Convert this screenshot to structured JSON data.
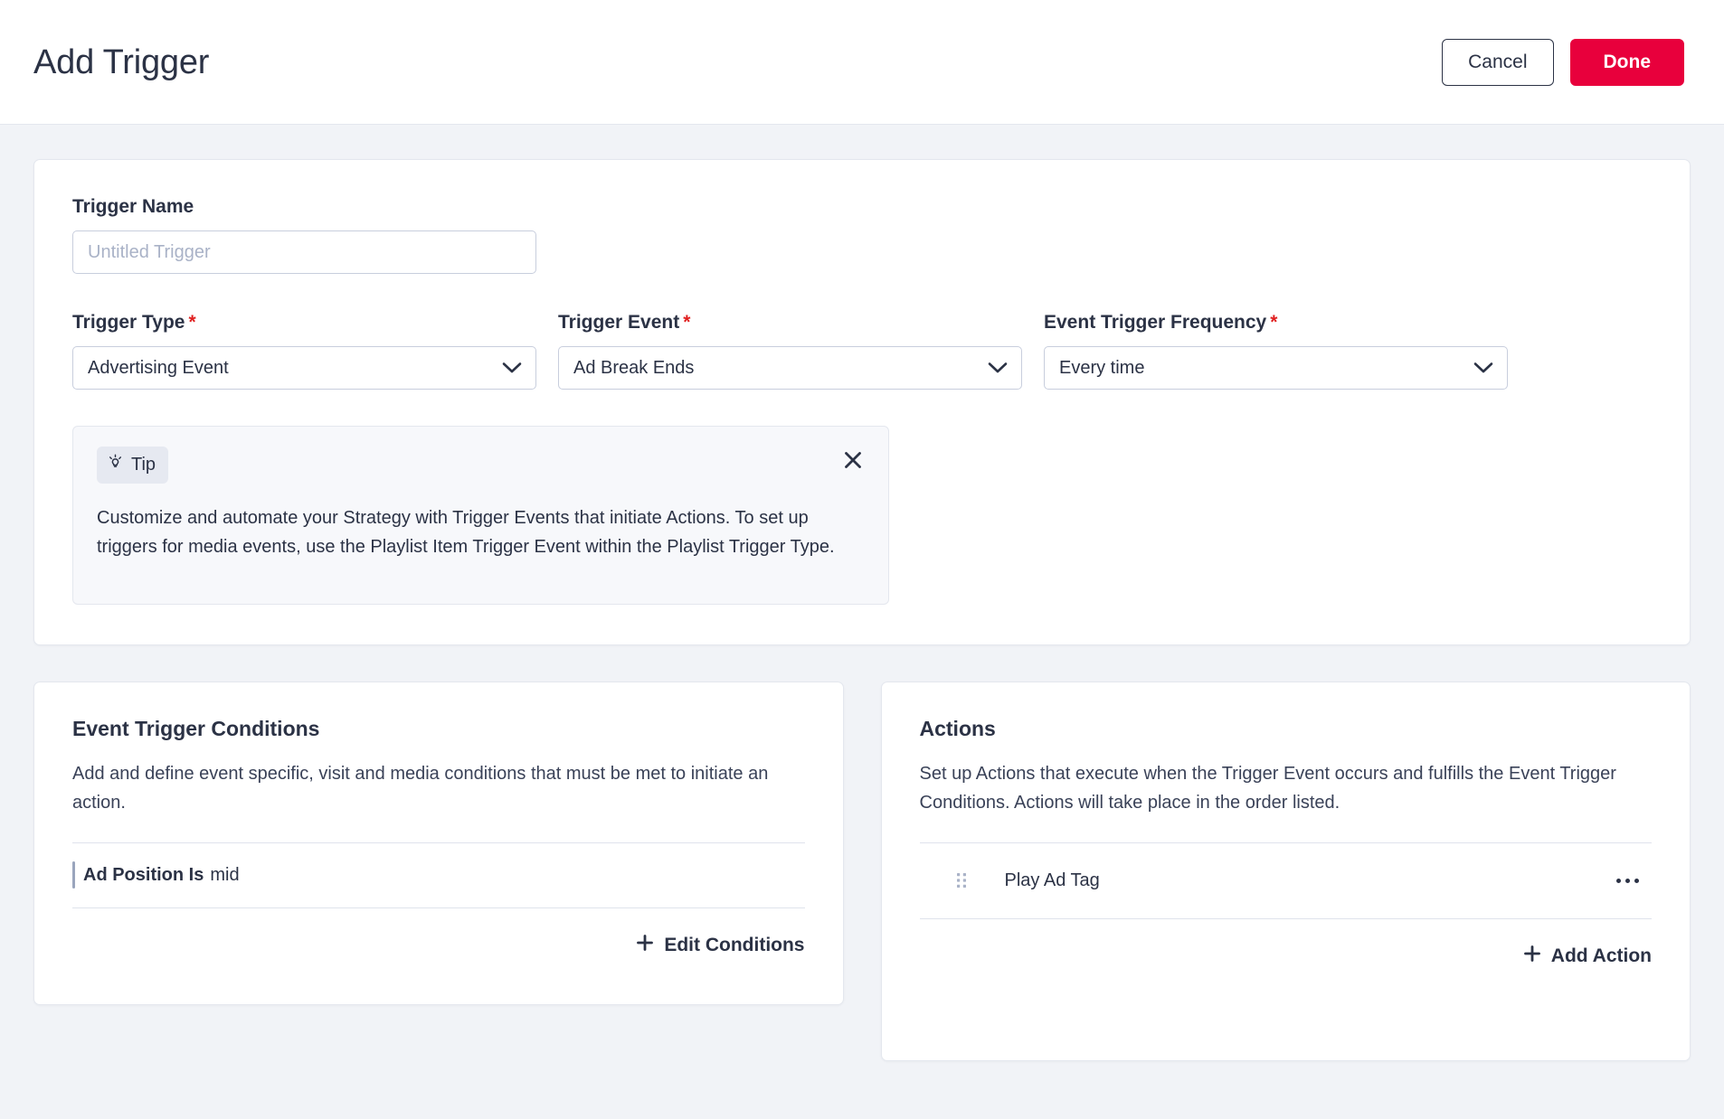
{
  "header": {
    "title": "Add Trigger",
    "cancel_label": "Cancel",
    "done_label": "Done",
    "accent_color": "#e8003c"
  },
  "form": {
    "trigger_name": {
      "label": "Trigger Name",
      "value": "",
      "placeholder": "Untitled Trigger"
    },
    "trigger_type": {
      "label": "Trigger Type",
      "required_marker": "*",
      "value": "Advertising Event"
    },
    "trigger_event": {
      "label": "Trigger Event",
      "required_marker": "*",
      "value": "Ad Break Ends"
    },
    "event_trigger_frequency": {
      "label": "Event Trigger Frequency",
      "required_marker": "*",
      "value": "Every time"
    }
  },
  "tip": {
    "badge_label": "Tip",
    "badge_icon": "lightbulb-icon",
    "close_icon": "close-icon",
    "text": "Customize and automate your Strategy with Trigger Events that initiate Actions. To set up triggers for media events, use the Playlist Item Trigger Event within the Playlist Trigger Type."
  },
  "conditions_panel": {
    "title": "Event Trigger Conditions",
    "description": "Add and define event specific, visit and media conditions that must be met to initiate an action.",
    "items": [
      {
        "key": "Ad Position Is",
        "value": "mid"
      }
    ],
    "edit_label": "Edit Conditions",
    "edit_icon": "plus-icon"
  },
  "actions_panel": {
    "title": "Actions",
    "description": "Set up Actions that execute when the Trigger Event occurs and fulfills the Event Trigger Conditions. Actions will take place in the order listed.",
    "items": [
      {
        "label": "Play Ad Tag",
        "drag_icon": "drag-handle-icon",
        "menu_icon": "ellipsis-icon"
      }
    ],
    "add_label": "Add Action",
    "add_icon": "plus-icon"
  }
}
